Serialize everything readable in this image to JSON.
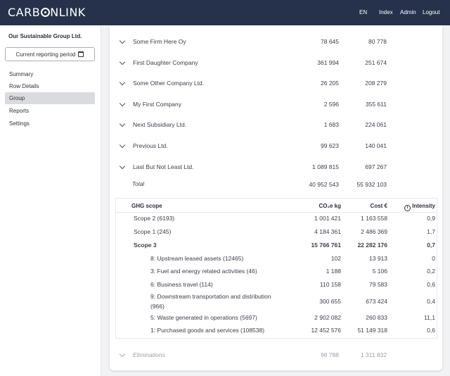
{
  "header": {
    "logo": "CARB_NLINK",
    "logo_left": "CARB",
    "logo_right": "NLINK",
    "lang": "EN",
    "index": "Index",
    "admin": "Admin",
    "logout": "Logout"
  },
  "sidebar": {
    "org_name": "Our Sustainable Group Ltd.",
    "period_button": "Current reporting period",
    "items": [
      {
        "label": "Summary"
      },
      {
        "label": "Row Details"
      },
      {
        "label": "Group"
      },
      {
        "label": "Reports"
      },
      {
        "label": "Settings"
      }
    ]
  },
  "companies": [
    {
      "name": "Some Firm Here Oy",
      "co2": "78 645",
      "cost": "80 778"
    },
    {
      "name": "First Daughter Company",
      "co2": "361 994",
      "cost": "251 674"
    },
    {
      "name": "Some Other Company Ltd.",
      "co2": "26 205",
      "cost": "208 279"
    },
    {
      "name": "My First Company",
      "co2": "2 596",
      "cost": "355 611"
    },
    {
      "name": "Next Subsidiary Ltd.",
      "co2": "1 683",
      "cost": "224 061"
    },
    {
      "name": "Previous Ltd.",
      "co2": "99 623",
      "cost": "140 041"
    },
    {
      "name": "Last But Not Least Ltd.",
      "co2": "1 089 815",
      "cost": "697 267"
    }
  ],
  "total": {
    "label": "Total",
    "co2": "40 952 543",
    "cost": "55 932 103"
  },
  "ghg": {
    "headers": {
      "scope": "GHG scope",
      "co2": "CO₂e kg",
      "cost": "Cost €",
      "intensity": "Intensity"
    },
    "rows": [
      {
        "name": "Scope 2 (6193)",
        "co2": "1 001 421",
        "cost": "1 163 558",
        "intensity": "0,9"
      },
      {
        "name": "Scope 1 (245)",
        "co2": "4 184 361",
        "cost": "2 486 369",
        "intensity": "1,7"
      },
      {
        "name": "Scope 3",
        "co2": "15 766 761",
        "cost": "22 282 176",
        "intensity": "0,7"
      },
      {
        "name": "8: Upstream leased assets (12465)",
        "co2": "102",
        "cost": "13 913",
        "intensity": "0"
      },
      {
        "name": "3: Fuel and energy related activities (46)",
        "co2": "1 188",
        "cost": "5 106",
        "intensity": "0,2"
      },
      {
        "name": "6: Business travel (114)",
        "co2": "110 158",
        "cost": "79 583",
        "intensity": "0,6"
      },
      {
        "name": "9: Downstream transportation and distribution",
        "name2": "(966)",
        "co2": "300 655",
        "cost": "673 424",
        "intensity": "0,4"
      },
      {
        "name": "5: Waste generated in operations (5697)",
        "co2": "2 902 082",
        "cost": "260 833",
        "intensity": "11,1"
      },
      {
        "name": "1: Purchased goods and services (108538)",
        "co2": "12 452 576",
        "cost": "51 149 318",
        "intensity": "0,6"
      }
    ]
  },
  "eliminations": {
    "label": "Eliminations",
    "co2": "98 788",
    "cost": "1 311 832"
  }
}
